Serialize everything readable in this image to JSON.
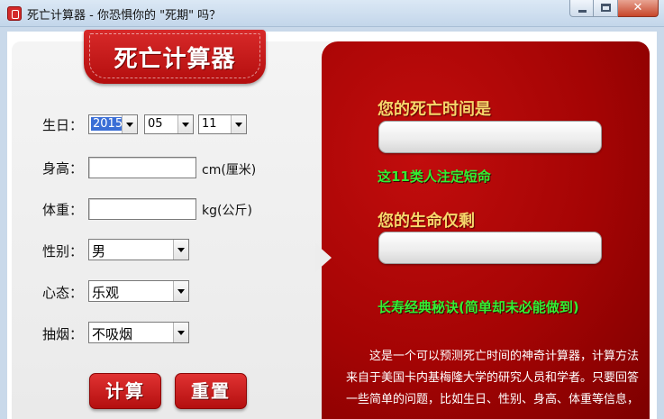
{
  "window": {
    "title": "死亡计算器 - 你恐惧你的 \"死期\" 吗？",
    "close_glyph": "✕"
  },
  "header": {
    "badge_text": "死亡计算器"
  },
  "form": {
    "birthday_label": "生日：",
    "birth_year": "2015",
    "birth_month": "05",
    "birth_day": "11",
    "height_label": "身高：",
    "height_value": "",
    "height_unit": "cm(厘米)",
    "weight_label": "体重：",
    "weight_value": "",
    "weight_unit": "kg(公斤)",
    "gender_label": "性别：",
    "gender_value": "男",
    "mood_label": "心态：",
    "mood_value": "乐观",
    "smoking_label": "抽烟：",
    "smoking_value": "不吸烟"
  },
  "buttons": {
    "calculate": "计算",
    "reset": "重置"
  },
  "results": {
    "death_time_label": "您的死亡时间是",
    "death_time_value": "",
    "doomed_text": "这11类人注定短命",
    "remaining_label": "您的生命仅剩",
    "remaining_value": "",
    "secret_link": "长寿经典秘诀(简单却未必能做到)"
  },
  "description": {
    "line1": "这是一个可以预测死亡时间的神奇计算器，计算方法",
    "line2": "来自于美国卡内基梅隆大学的研究人员和学者。只要回答",
    "line3": "一些简单的问题，比如生日、性别、身高、体重等信息，"
  },
  "colors": {
    "brand_red": "#b40f0f",
    "gold_text": "#f7d66b",
    "green_text": "#33ee33"
  }
}
